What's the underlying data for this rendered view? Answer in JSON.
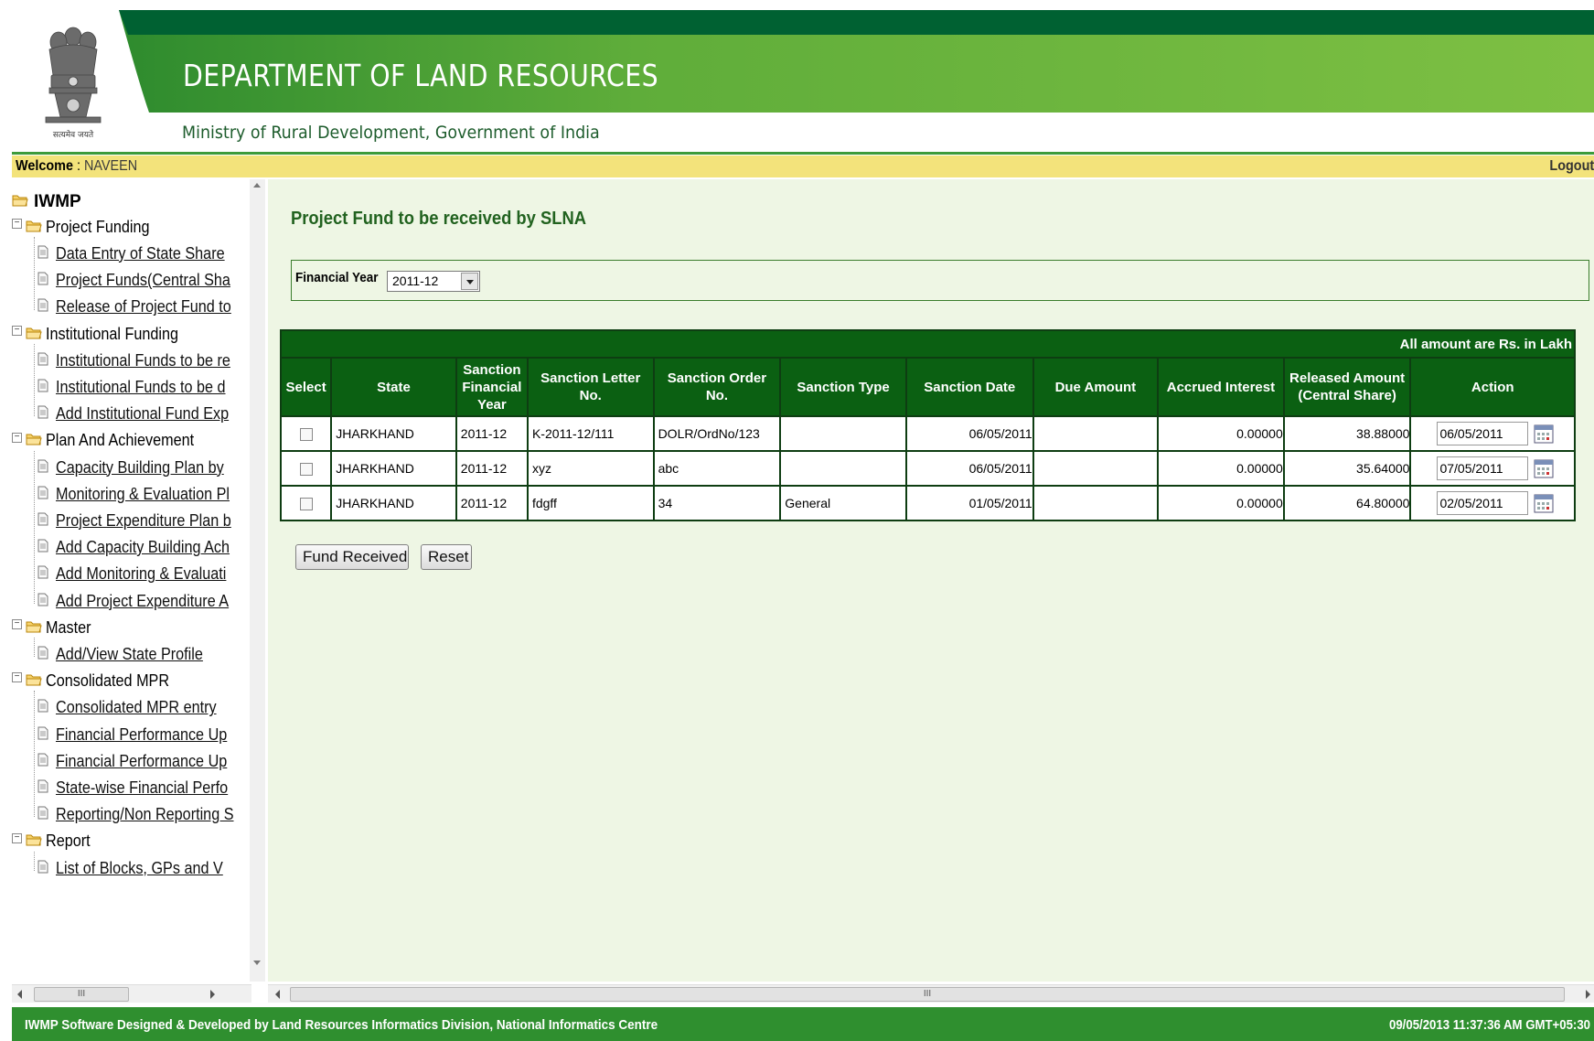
{
  "header": {
    "title": "DEPARTMENT OF LAND RESOURCES",
    "subtitle": "Ministry of Rural Development, Government of India",
    "emblem_caption": "सत्यमेव जयते",
    "banner_color_dark": "#006132",
    "banner_color_light": "#6cb33f"
  },
  "welcome_bar": {
    "label": "Welcome",
    "separator": " : ",
    "user": "NAVEEN",
    "logout": "Logout"
  },
  "sidebar": {
    "root": "IWMP",
    "groups": [
      {
        "label": "Project Funding",
        "items": [
          "Data Entry of State Share",
          "Project Funds(Central Sha",
          "Release of Project Fund to"
        ]
      },
      {
        "label": "Institutional Funding",
        "items": [
          "Institutional Funds to be re",
          "Institutional Funds to be d",
          "Add Institutional Fund Exp"
        ]
      },
      {
        "label": "Plan And Achievement",
        "items": [
          "Capacity Building Plan by",
          "Monitoring & Evaluation Pl",
          "Project Expenditure Plan b",
          "Add Capacity Building Ach",
          "Add Monitoring & Evaluati",
          "Add Project Expenditure A"
        ]
      },
      {
        "label": "Master",
        "items": [
          "Add/View State Profile"
        ]
      },
      {
        "label": "Consolidated MPR",
        "items": [
          "Consolidated MPR entry",
          "Financial Performance Up",
          "Financial Performance Up",
          "State-wise Financial Perfo",
          "Reporting/Non Reporting S"
        ]
      },
      {
        "label": "Report",
        "items": [
          "List of Blocks, GPs and V"
        ]
      }
    ]
  },
  "main": {
    "page_title": "Project Fund to be received by SLNA",
    "filter": {
      "label": "Financial Year",
      "selected": "2011-12"
    },
    "table": {
      "note": "All amount are Rs. in Lakh",
      "columns": [
        "Select",
        "State",
        "Sanction Financial Year",
        "Sanction Letter No.",
        "Sanction Order No.",
        "Sanction Type",
        "Sanction Date",
        "Due Amount",
        "Accrued Interest",
        "Released Amount (Central Share)",
        "Action"
      ],
      "rows": [
        {
          "state": "JHARKHAND",
          "fin_year": "2011-12",
          "letter_no": "K-2011-12/111",
          "order_no": "DOLR/OrdNo/123",
          "type": "",
          "date": "06/05/2011",
          "due": "",
          "interest": "0.00000",
          "released": "38.88000",
          "action_date": "06/05/2011"
        },
        {
          "state": "JHARKHAND",
          "fin_year": "2011-12",
          "letter_no": "xyz",
          "order_no": "abc",
          "type": "",
          "date": "06/05/2011",
          "due": "",
          "interest": "0.00000",
          "released": "35.64000",
          "action_date": "07/05/2011"
        },
        {
          "state": "JHARKHAND",
          "fin_year": "2011-12",
          "letter_no": "fdgff",
          "order_no": "34",
          "type": "General",
          "date": "01/05/2011",
          "due": "",
          "interest": "0.00000",
          "released": "64.80000",
          "action_date": "02/05/2011"
        }
      ]
    },
    "buttons": {
      "submit": "Fund Received",
      "reset": "Reset"
    }
  },
  "scrollbars": {
    "thumb_grip": "III"
  },
  "footer": {
    "credit": "IWMP Software Designed & Developed by Land Resources Informatics Division, National Informatics Centre",
    "timestamp": "09/05/2013 11:37:36 AM GMT+05:30"
  }
}
